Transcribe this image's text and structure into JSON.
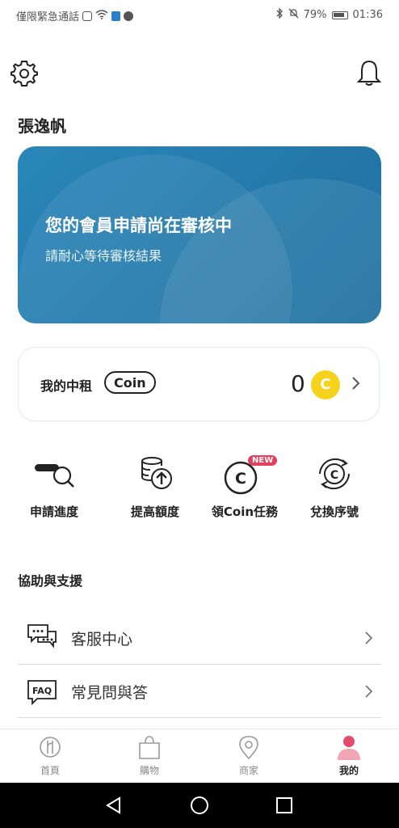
{
  "status_bar": {
    "carrier": "僅限緊急通話",
    "battery": "79%",
    "time": "01:36"
  },
  "header": {
    "settings_icon": "gear-icon",
    "notifications_icon": "bell-icon"
  },
  "user": {
    "name": "張逸帆"
  },
  "banner": {
    "title": "您的會員申請尚在審核中",
    "subtitle": "請耐心等待審核結果",
    "bg": "#2a86b9"
  },
  "coin_card": {
    "label": "我的中租",
    "pill": "Coin",
    "amount": "0",
    "coin_symbol": "C",
    "coin_color": "#f7d21c"
  },
  "quick_actions": [
    {
      "label": "申請進度",
      "icon": "search-progress-icon"
    },
    {
      "label": "提高額度",
      "icon": "coins-up-icon"
    },
    {
      "label": "領Coin任務",
      "icon": "coin-task-icon",
      "badge": "NEW"
    },
    {
      "label": "兌換序號",
      "icon": "coin-exchange-icon"
    }
  ],
  "support": {
    "title": "協助與支援",
    "items": [
      {
        "label": "客服中心",
        "icon": "chat-bubbles-icon"
      },
      {
        "label": "常見問與答",
        "icon": "faq-icon",
        "icon_text": "FAQ"
      }
    ]
  },
  "tabs": [
    {
      "label": "首頁",
      "icon": "home-icon"
    },
    {
      "label": "購物",
      "icon": "shopping-bag-icon"
    },
    {
      "label": "商家",
      "icon": "location-pin-icon"
    },
    {
      "label": "我的",
      "icon": "profile-icon",
      "active": true
    }
  ]
}
